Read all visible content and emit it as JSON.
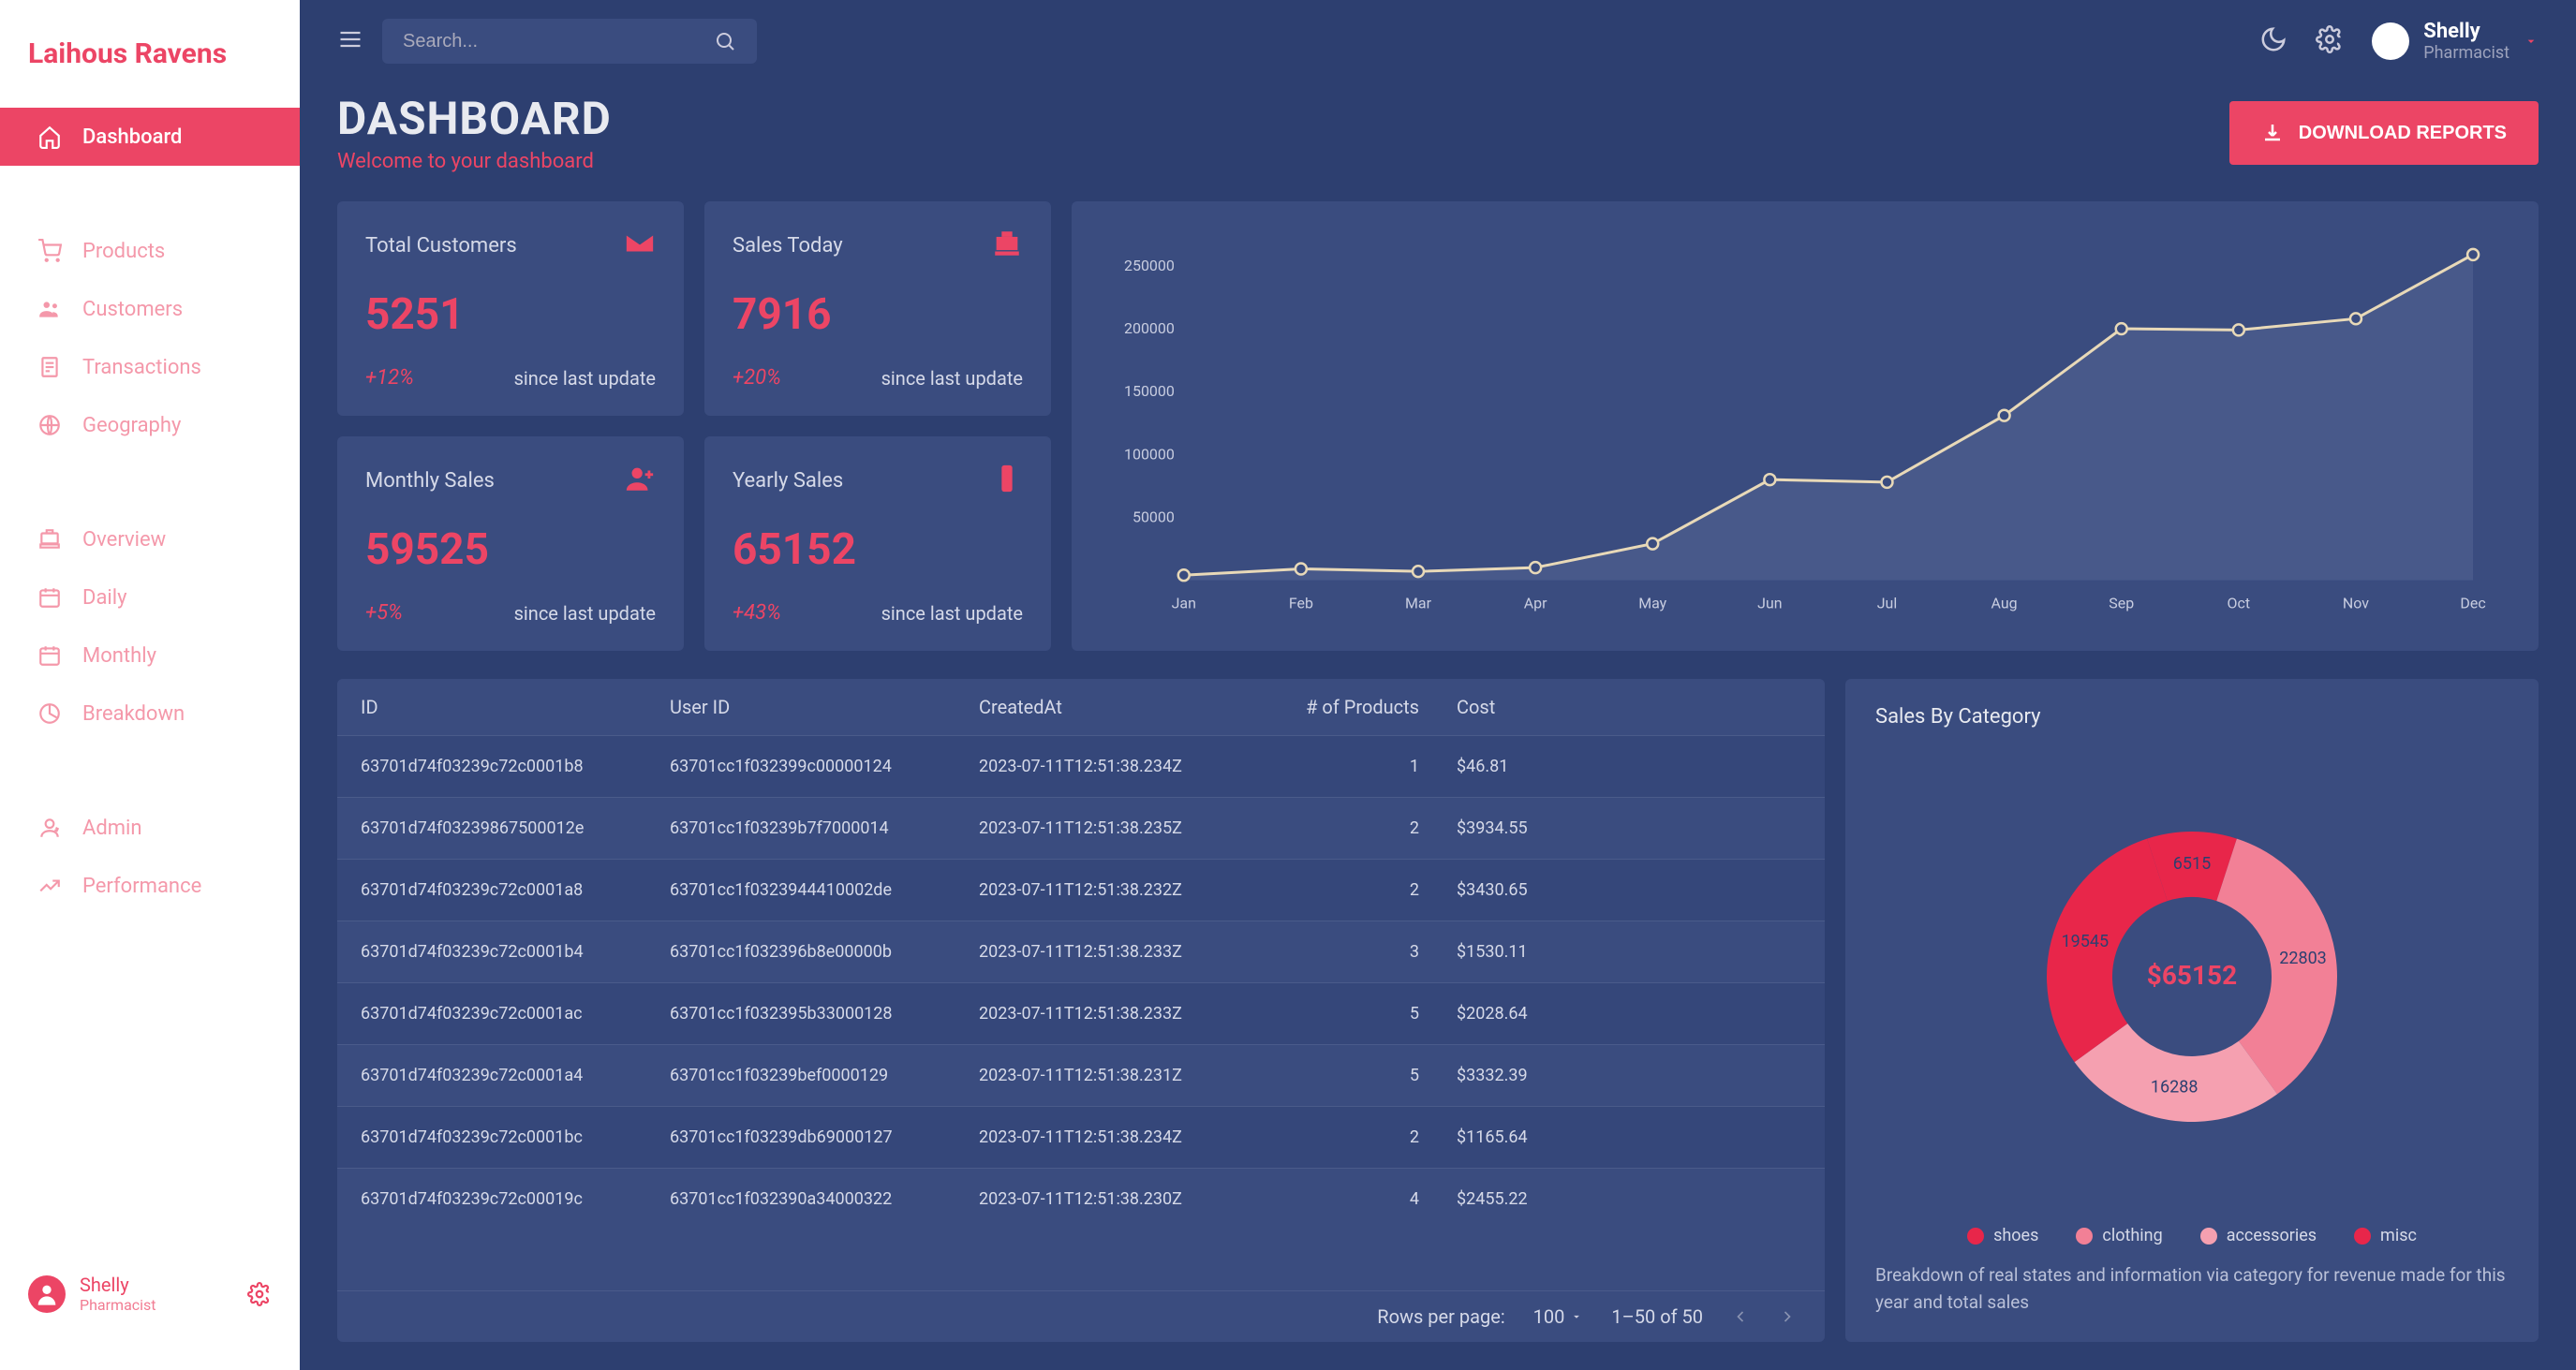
{
  "brand": "Laihous Ravens",
  "sidebar": {
    "items": [
      {
        "label": "Dashboard"
      },
      {
        "label": "Products"
      },
      {
        "label": "Customers"
      },
      {
        "label": "Transactions"
      },
      {
        "label": "Geography"
      },
      {
        "label": "Overview"
      },
      {
        "label": "Daily"
      },
      {
        "label": "Monthly"
      },
      {
        "label": "Breakdown"
      },
      {
        "label": "Admin"
      },
      {
        "label": "Performance"
      }
    ],
    "user": {
      "name": "Shelly",
      "role": "Pharmacist"
    }
  },
  "search": {
    "placeholder": "Search..."
  },
  "topuser": {
    "name": "Shelly",
    "role": "Pharmacist"
  },
  "header": {
    "title": "DASHBOARD",
    "subtitle": "Welcome to your dashboard",
    "download": "DOWNLOAD REPORTS"
  },
  "stats": [
    {
      "title": "Total Customers",
      "value": "5251",
      "pct": "+12%",
      "since": "since last update"
    },
    {
      "title": "Sales Today",
      "value": "7916",
      "pct": "+20%",
      "since": "since last update"
    },
    {
      "title": "Monthly Sales",
      "value": "59525",
      "pct": "+5%",
      "since": "since last update"
    },
    {
      "title": "Yearly Sales",
      "value": "65152",
      "pct": "+43%",
      "since": "since last update"
    }
  ],
  "line_x": [
    "Jan",
    "Feb",
    "Mar",
    "Apr",
    "May",
    "Jun",
    "Jul",
    "Aug",
    "Sep",
    "Oct",
    "Nov",
    "Dec"
  ],
  "line_yticks": [
    "50000",
    "100000",
    "150000",
    "200000",
    "250000"
  ],
  "table": {
    "headers": {
      "id": "ID",
      "uid": "User ID",
      "created": "CreatedAt",
      "num": "# of Products",
      "cost": "Cost"
    },
    "rows": [
      {
        "id": "63701d74f03239c72c0001b8",
        "uid": "63701cc1f032399c00000124",
        "created": "2023-07-11T12:51:38.234Z",
        "num": "1",
        "cost": "$46.81"
      },
      {
        "id": "63701d74f03239867500012e",
        "uid": "63701cc1f03239b7f7000014",
        "created": "2023-07-11T12:51:38.235Z",
        "num": "2",
        "cost": "$3934.55"
      },
      {
        "id": "63701d74f03239c72c0001a8",
        "uid": "63701cc1f0323944410002de",
        "created": "2023-07-11T12:51:38.232Z",
        "num": "2",
        "cost": "$3430.65"
      },
      {
        "id": "63701d74f03239c72c0001b4",
        "uid": "63701cc1f032396b8e00000b",
        "created": "2023-07-11T12:51:38.233Z",
        "num": "3",
        "cost": "$1530.11"
      },
      {
        "id": "63701d74f03239c72c0001ac",
        "uid": "63701cc1f032395b33000128",
        "created": "2023-07-11T12:51:38.233Z",
        "num": "5",
        "cost": "$2028.64"
      },
      {
        "id": "63701d74f03239c72c0001a4",
        "uid": "63701cc1f03239bef0000129",
        "created": "2023-07-11T12:51:38.231Z",
        "num": "5",
        "cost": "$3332.39"
      },
      {
        "id": "63701d74f03239c72c0001bc",
        "uid": "63701cc1f03239db69000127",
        "created": "2023-07-11T12:51:38.234Z",
        "num": "2",
        "cost": "$1165.64"
      },
      {
        "id": "63701d74f03239c72c00019c",
        "uid": "63701cc1f032390a34000322",
        "created": "2023-07-11T12:51:38.230Z",
        "num": "4",
        "cost": "$2455.22"
      }
    ],
    "footer": {
      "rpp_label": "Rows per page:",
      "rpp_value": "100",
      "range": "1–50 of 50"
    }
  },
  "donut": {
    "title": "Sales By Category",
    "center": "$65152",
    "legend": [
      "shoes",
      "clothing",
      "accessories",
      "misc"
    ],
    "labels": [
      "6515",
      "22803",
      "16288",
      "19545"
    ],
    "desc": "Breakdown of real states and information via category for revenue made for this year and total sales"
  },
  "chart_data": [
    {
      "type": "line",
      "title": "",
      "categories": [
        "Jan",
        "Feb",
        "Mar",
        "Apr",
        "May",
        "Jun",
        "Jul",
        "Aug",
        "Sep",
        "Oct",
        "Nov",
        "Dec"
      ],
      "values": [
        4000,
        9000,
        7000,
        10000,
        29000,
        80000,
        78000,
        131000,
        200000,
        199000,
        208000,
        259000
      ],
      "xlabel": "",
      "ylabel": "",
      "ylim": [
        0,
        260000
      ]
    },
    {
      "type": "pie",
      "title": "Sales By Category",
      "categories": [
        "shoes",
        "clothing",
        "accessories",
        "misc"
      ],
      "values": [
        6515,
        22803,
        16288,
        19545
      ],
      "total_label": "$65152"
    }
  ]
}
